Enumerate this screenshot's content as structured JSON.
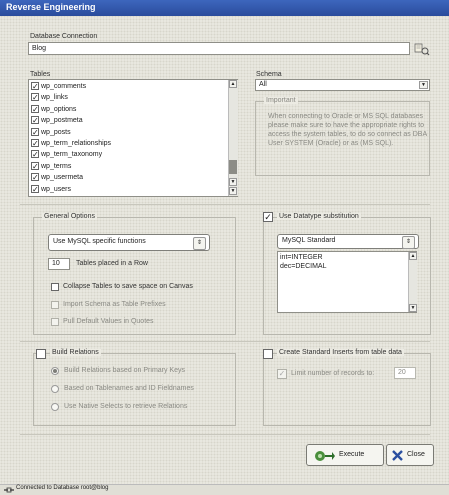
{
  "window": {
    "title": "Reverse Engineering"
  },
  "connection": {
    "label": "Database Connection",
    "value": "Blog"
  },
  "tables": {
    "label": "Tables",
    "items": [
      {
        "label": "wp_comments",
        "checked": true
      },
      {
        "label": "wp_links",
        "checked": true
      },
      {
        "label": "wp_options",
        "checked": true
      },
      {
        "label": "wp_postmeta",
        "checked": true
      },
      {
        "label": "wp_posts",
        "checked": true
      },
      {
        "label": "wp_term_relationships",
        "checked": true
      },
      {
        "label": "wp_term_taxonomy",
        "checked": true
      },
      {
        "label": "wp_terms",
        "checked": true
      },
      {
        "label": "wp_usermeta",
        "checked": true
      },
      {
        "label": "wp_users",
        "checked": true
      }
    ]
  },
  "schema": {
    "label": "Schema",
    "value": "All",
    "important_title": "Important",
    "important_text": "When connecting to Oracle or MS SQL databases please make sure to have the appropriate rights to access the system tables, to do so connect as DBA User SYSTEM (Oracle) or as (MS SQL)."
  },
  "general": {
    "title": "General Options",
    "function_select": "Use MySQL specific functions",
    "tables_per_row_value": "10",
    "tables_per_row_label": "Tables placed in a Row",
    "collapse_label": "Collapse Tables to save space on Canvas",
    "import_schema_label": "Import Schema as Table Prefixes",
    "pull_defaults_label": "Pull Default Values in Quotes"
  },
  "datatype": {
    "title": "Use Datatype substitution",
    "select": "MySQL Standard",
    "lines": [
      "int=INTEGER",
      "dec=DECIMAL"
    ]
  },
  "relations": {
    "title": "Build Relations",
    "options": [
      "Build Relations based on Primary Keys",
      "Based on Tablenames and ID Fieldnames",
      "Use Native Selects to retrieve Relations"
    ]
  },
  "inserts": {
    "title": "Create Standard Inserts from table data",
    "limit_label": "Limit number of records to:",
    "limit_value": "20"
  },
  "buttons": {
    "execute": "Execute",
    "close": "Close"
  },
  "status": {
    "text": "Connected to Database root@blog"
  }
}
